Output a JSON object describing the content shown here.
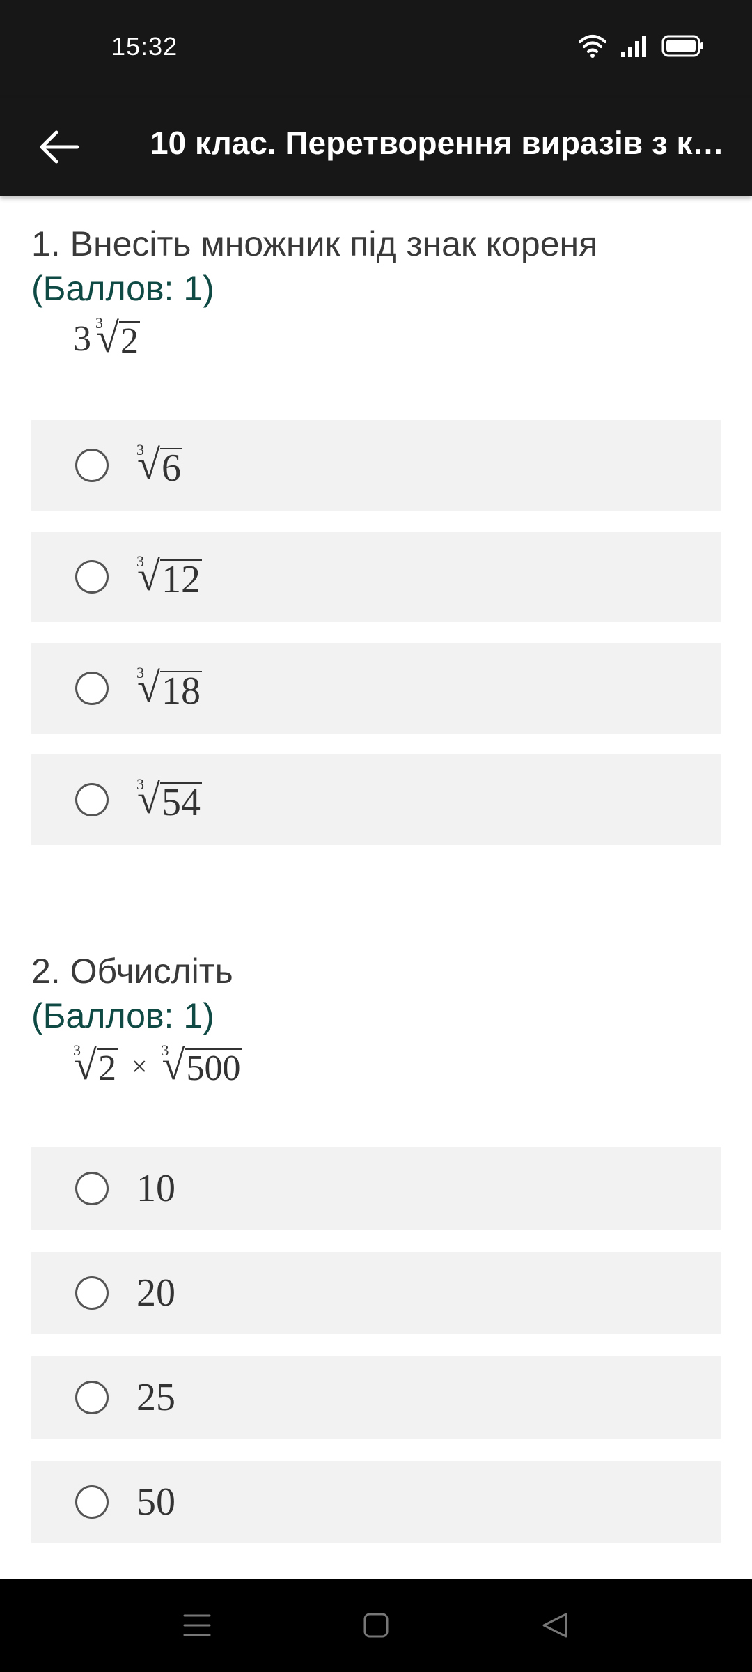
{
  "status": {
    "time": "15:32"
  },
  "app_bar": {
    "title": "10 клас. Перетворення виразів з ко…"
  },
  "questions": [
    {
      "number": "1.",
      "title": "Внесіть множник під знак кореня",
      "points": "(Баллов: 1)",
      "expression": {
        "coefficient": "3",
        "index": "3",
        "radicand": "2"
      },
      "options": [
        {
          "index": "3",
          "radicand": "6"
        },
        {
          "index": "3",
          "radicand": "12"
        },
        {
          "index": "3",
          "radicand": "18"
        },
        {
          "index": "3",
          "radicand": "54"
        }
      ]
    },
    {
      "number": "2.",
      "title": "Обчисліть",
      "points": "(Баллов: 1)",
      "expression": {
        "left_index": "3",
        "left_radicand": "2",
        "operator": "×",
        "right_index": "3",
        "right_radicand": "500"
      },
      "options": [
        {
          "label": "10"
        },
        {
          "label": "20"
        },
        {
          "label": "25"
        },
        {
          "label": "50"
        }
      ]
    }
  ],
  "icons": {
    "back": "arrow-left-icon",
    "wifi": "wifi-icon",
    "signal": "signal-icon",
    "battery": "battery-icon",
    "nav_menu": "menu-icon",
    "nav_home": "home-icon",
    "nav_back": "triangle-back-icon"
  },
  "colors": {
    "bars": "#171717",
    "points": "#0f4a45",
    "option_bg": "#f2f2f2"
  }
}
